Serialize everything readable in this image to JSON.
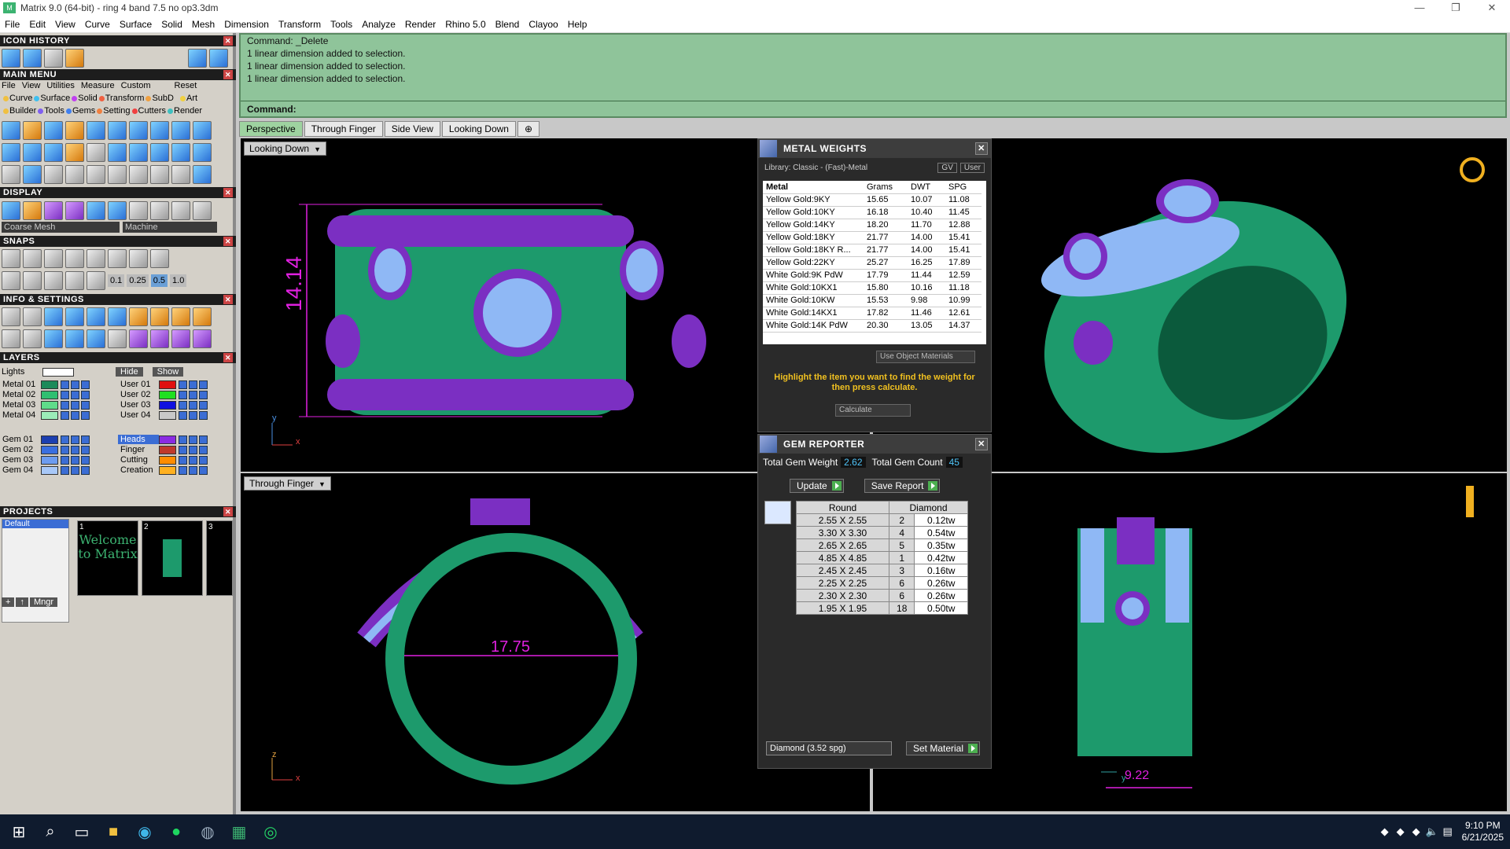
{
  "window": {
    "title": "Matrix 9.0 (64-bit) - ring 4 band 7.5 no op3.3dm"
  },
  "menu": [
    "File",
    "Edit",
    "View",
    "Curve",
    "Surface",
    "Solid",
    "Mesh",
    "Dimension",
    "Transform",
    "Tools",
    "Analyze",
    "Render",
    "Rhino 5.0",
    "Blend",
    "Clayoo",
    "Help"
  ],
  "left": {
    "icon_history": "ICON HISTORY",
    "main_menu": "MAIN MENU",
    "main_menu_items": [
      "File",
      "View",
      "Utilities",
      "Measure",
      "Custom"
    ],
    "reset": "Reset",
    "cat_row1": [
      "Curve",
      "Surface",
      "Solid",
      "Transform",
      "SubD",
      "Art"
    ],
    "cat_row2": [
      "Builder",
      "Tools",
      "Gems",
      "Setting",
      "Cutters",
      "Render"
    ],
    "display": "DISPLAY",
    "coarse_mesh": "Coarse Mesh",
    "machine": "Machine",
    "snaps": "SNAPS",
    "snap_values": [
      "0.1",
      "0.25",
      "0.5",
      "1.0"
    ],
    "info_settings": "INFO & SETTINGS",
    "layers": "LAYERS",
    "lights": "Lights",
    "hide": "Hide",
    "show": "Show",
    "layers_left": [
      {
        "name": "Metal 01",
        "color": "#1b8a5a"
      },
      {
        "name": "Metal 02",
        "color": "#2fbf71"
      },
      {
        "name": "Metal 03",
        "color": "#5fdc8a"
      },
      {
        "name": "Metal 04",
        "color": "#9cecb8"
      },
      {
        "name": "Gem 01",
        "color": "#1c3fb0"
      },
      {
        "name": "Gem 02",
        "color": "#3a6fe0"
      },
      {
        "name": "Gem 03",
        "color": "#6d9cf0"
      },
      {
        "name": "Gem 04",
        "color": "#a8c8f8"
      }
    ],
    "layers_right": [
      {
        "name": "User 01",
        "color": "#e01010"
      },
      {
        "name": "User 02",
        "color": "#20e020"
      },
      {
        "name": "User 03",
        "color": "#1010e0"
      },
      {
        "name": "User 04",
        "color": "#c8c8c8"
      },
      {
        "name": "Heads",
        "color": "#8a2be2"
      },
      {
        "name": "Finger",
        "color": "#c0392b"
      },
      {
        "name": "Cutting",
        "color": "#ff8c00"
      },
      {
        "name": "Creation",
        "color": "#ffb020"
      }
    ],
    "projects": "PROJECTS",
    "project_default": "Default",
    "thumbs": [
      "1",
      "2",
      "3"
    ],
    "welcome_text": "Welcome to Matrix",
    "mngr": "Mngr"
  },
  "command": {
    "lines": [
      "Command: _Delete",
      "1 linear dimension added to selection.",
      "1 linear dimension added to selection.",
      "1 linear dimension added to selection."
    ],
    "prompt": "Command:"
  },
  "tabs": [
    "Perspective",
    "Through Finger",
    "Side View",
    "Looking Down"
  ],
  "viewports": {
    "top_left": "Looking Down",
    "bottom_left": "Through Finger",
    "dim_height": "14.14",
    "dim_inner": "17.75",
    "dim_width": "9.22",
    "axis_x": "x",
    "axis_y": "y",
    "axis_z": "z"
  },
  "metal_weights": {
    "title": "METAL WEIGHTS",
    "library": "Library: Classic - (Fast)-Metal",
    "gv": "GV",
    "user": "User",
    "headers": [
      "Metal",
      "Grams",
      "DWT",
      "SPG"
    ],
    "rows": [
      [
        "Yellow Gold:9KY",
        "15.65",
        "10.07",
        "11.08"
      ],
      [
        "Yellow Gold:10KY",
        "16.18",
        "10.40",
        "11.45"
      ],
      [
        "Yellow Gold:14KY",
        "18.20",
        "11.70",
        "12.88"
      ],
      [
        "Yellow Gold:18KY",
        "21.77",
        "14.00",
        "15.41"
      ],
      [
        "Yellow Gold:18KY R...",
        "21.77",
        "14.00",
        "15.41"
      ],
      [
        "Yellow Gold:22KY",
        "25.27",
        "16.25",
        "17.89"
      ],
      [
        "White Gold:9K PdW",
        "17.79",
        "11.44",
        "12.59"
      ],
      [
        "White Gold:10KX1",
        "15.80",
        "10.16",
        "11.18"
      ],
      [
        "White Gold:10KW",
        "15.53",
        "9.98",
        "10.99"
      ],
      [
        "White Gold:14KX1",
        "17.82",
        "11.46",
        "12.61"
      ],
      [
        "White Gold:14K PdW",
        "20.30",
        "13.05",
        "14.37"
      ]
    ],
    "use_object": "Use Object Materials",
    "hint": "Highlight the item you want to find the weight for then press calculate.",
    "calculate": "Calculate"
  },
  "gem_reporter": {
    "title": "GEM REPORTER",
    "total_weight_label": "Total Gem Weight",
    "total_weight": "2.62",
    "total_count_label": "Total Gem Count",
    "total_count": "45",
    "update": "Update",
    "save_report": "Save Report",
    "col_shape": "Round",
    "col_type": "Diamond",
    "rows": [
      [
        "2.55 X 2.55",
        "2",
        "0.12tw"
      ],
      [
        "3.30 X 3.30",
        "4",
        "0.54tw"
      ],
      [
        "2.65 X 2.65",
        "5",
        "0.35tw"
      ],
      [
        "4.85 X 4.85",
        "1",
        "0.42tw"
      ],
      [
        "2.45 X 2.45",
        "3",
        "0.16tw"
      ],
      [
        "2.25 X 2.25",
        "6",
        "0.26tw"
      ],
      [
        "2.30 X 2.30",
        "6",
        "0.26tw"
      ],
      [
        "1.95 X 1.95",
        "18",
        "0.50tw"
      ]
    ],
    "material": "Diamond    (3.52 spg)",
    "set_material": "Set Material"
  },
  "taskbar": {
    "time": "9:10 PM",
    "date": "6/21/2025"
  }
}
